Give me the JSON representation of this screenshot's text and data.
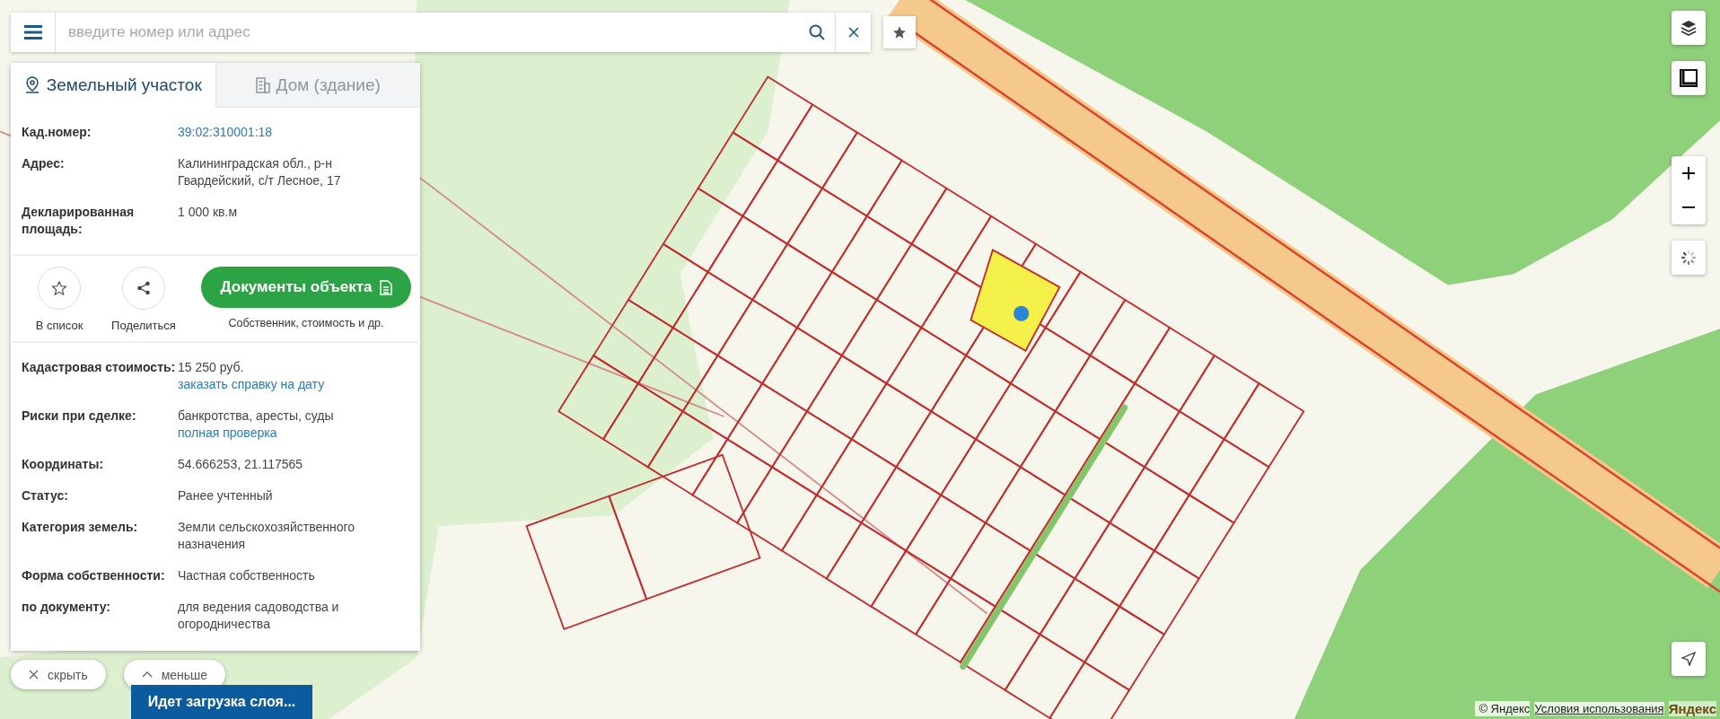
{
  "search": {
    "placeholder": "введите номер или адрес"
  },
  "tabs": [
    {
      "label": "Земельный участок",
      "selected": true,
      "kind": "parcel"
    },
    {
      "label": "Дом (здание)",
      "selected": false,
      "kind": "building"
    }
  ],
  "info_top": [
    {
      "label": "Кад.номер:",
      "lines": [
        {
          "text": "39:02:310001:18",
          "link": true
        }
      ]
    },
    {
      "label": "Адрес:",
      "lines": [
        {
          "text": "Калининградская обл., р-н Гвардейский, с/т Лесное, 17",
          "link": false
        }
      ]
    },
    {
      "label": "Декларированная площадь:",
      "lines": [
        {
          "text": "1 000 кв.м",
          "link": false
        }
      ]
    }
  ],
  "actions": [
    {
      "label": "В список",
      "kind": "star"
    },
    {
      "label": "Поделиться",
      "kind": "share"
    }
  ],
  "documents": {
    "label": "Документы объекта",
    "caption": "Собственник, стоимость и др."
  },
  "info_bottom": [
    {
      "label": "Кадастровая стоимость:",
      "lines": [
        {
          "text": "15 250 руб.",
          "link": false
        },
        {
          "text": "заказать справку на дату",
          "link": true
        }
      ]
    },
    {
      "label": "Риски при сделке:",
      "lines": [
        {
          "text": "банкротства, аресты, суды",
          "link": false
        },
        {
          "text": "полная проверка",
          "link": true
        }
      ]
    },
    {
      "label": "Координаты:",
      "lines": [
        {
          "text": "54.666253, 21.117565",
          "link": false
        }
      ]
    },
    {
      "label": "Статус:",
      "lines": [
        {
          "text": "Ранее учтенный",
          "link": false
        }
      ]
    },
    {
      "label": "Категория земель:",
      "lines": [
        {
          "text": "Земли сельскохозяйственного назначения",
          "link": false
        }
      ]
    },
    {
      "label": "Форма собственности:",
      "lines": [
        {
          "text": "Частная собственность",
          "link": false
        }
      ]
    },
    {
      "label": "по документу:",
      "lines": [
        {
          "text": "для ведения садоводства и огородничества",
          "link": false
        }
      ]
    }
  ],
  "panel_buttons": [
    {
      "label": "скрыть",
      "kind": "close"
    },
    {
      "label": "меньше",
      "kind": "collapse"
    }
  ],
  "loading_banner": "Идет загрузка слоя...",
  "attribution": {
    "copyright": "© Яндекс",
    "terms": "Условия использования",
    "logo": "Яндекс"
  }
}
